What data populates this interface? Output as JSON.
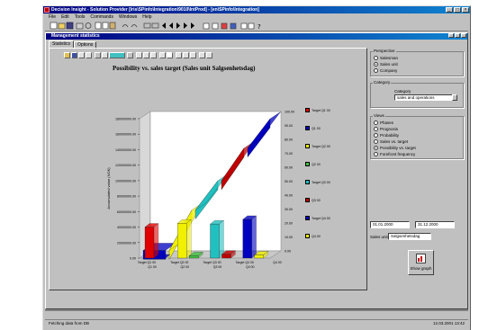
{
  "window": {
    "title": "Decision Insight - Solution Provider [Iris\\SPinfo\\Integration\\9010\\IntProd] - [en\\SPinfo\\Integration]",
    "controls": [
      "_",
      "□",
      "×"
    ]
  },
  "menu": [
    "File",
    "Edit",
    "Tools",
    "Commands",
    "Windows",
    "Help"
  ],
  "child": {
    "title": "Management statistics",
    "tabs": [
      "Statistics",
      "Options"
    ],
    "active_tab": "Statistics"
  },
  "chart_data": {
    "type": "bar",
    "title": "Possibility vs. sales target (Sales unit Salgsenhetsdag)",
    "ylabel": "Accumulated value (NOK)",
    "ylim": [
      0,
      180000000
    ],
    "yticks": [
      "180000000.00",
      "160000000.00",
      "140000000.00",
      "120000000.00",
      "100000000.00",
      "80000000.00",
      "60000000.00",
      "40000000.00",
      "20000000.00",
      "0.00"
    ],
    "right_ticks": [
      "100.00",
      "90.00",
      "80.00",
      "70.00",
      "60.00",
      "50.00",
      "40.00",
      "30.00",
      "20.00",
      "10.00",
      "0.00"
    ],
    "categories": [
      "Target Q1 00",
      "Target Q2 00",
      "Target Q3 00",
      "Target Q4 00",
      "Q4 00"
    ],
    "sub_categories": [
      "Q1 00",
      "Q2 00",
      "Q3 00",
      "Q4 00"
    ],
    "series": [
      {
        "name": "Target Q1 00",
        "color": "#e00000",
        "values": [
          40000000
        ]
      },
      {
        "name": "Q1 00",
        "color": "#0000c0",
        "values": [
          0
        ]
      },
      {
        "name": "Target Q2 00",
        "color": "#f0f000",
        "values": [
          45000000
        ]
      },
      {
        "name": "Q2 00",
        "color": "#40c040",
        "values": [
          3000000
        ]
      },
      {
        "name": "Target Q3 00",
        "color": "#20c0c0",
        "values": [
          44000000
        ]
      },
      {
        "name": "Q3 00",
        "color": "#c00000",
        "values": [
          5000000
        ]
      },
      {
        "name": "Target Q4 00",
        "color": "#0000c0",
        "values": [
          50000000
        ]
      },
      {
        "name": "Q4 00",
        "color": "#f0f000",
        "values": [
          4000000
        ]
      }
    ],
    "ribbon_values": [
      10000000,
      62000000,
      100000000,
      142000000,
      180000000
    ],
    "ribbon_colors": [
      "#0000c0",
      "#f0f000",
      "#20c0c0",
      "#c00000",
      "#0000c0"
    ]
  },
  "side": {
    "perspective": {
      "label": "Perspective",
      "options": [
        "Salesman",
        "Sales unit",
        "Company"
      ],
      "selected": 1
    },
    "category": {
      "label": "Category",
      "sublabel": "Category",
      "value": "sales and operations"
    },
    "views": {
      "label": "Views",
      "options": [
        "Phases",
        "Prognosis",
        "Probability",
        "Sales vs. target",
        "Possibility vs. target",
        "Forefront frequency"
      ],
      "selected": 4
    },
    "date_from": "01.01.2000",
    "date_to": "31.12.2000",
    "sales_unit_label": "Sales unit",
    "sales_unit_value": "Salgsenhetsdag",
    "show_button": "Show graph"
  },
  "status": {
    "left": "Fetching data from DB",
    "right": "12.03.2001  13:42"
  },
  "colors": {
    "title_start": "#000080",
    "title_end": "#1084d0",
    "face": "#c0c0c0"
  }
}
